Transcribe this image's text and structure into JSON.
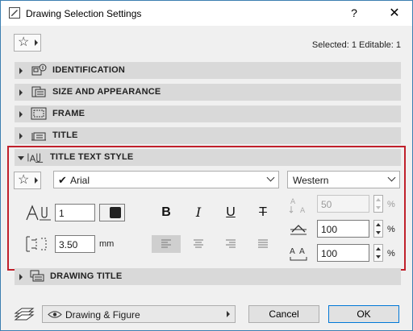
{
  "window": {
    "title": "Drawing Selection Settings",
    "help_label": "?",
    "close_label": "✕"
  },
  "toolbar": {
    "selection_info": "Selected: 1 Editable: 1"
  },
  "panels": [
    {
      "label": "IDENTIFICATION",
      "icon": "identification-icon",
      "expanded": false
    },
    {
      "label": "SIZE AND APPEARANCE",
      "icon": "size-appearance-icon",
      "expanded": false
    },
    {
      "label": "FRAME",
      "icon": "frame-icon",
      "expanded": false
    },
    {
      "label": "TITLE",
      "icon": "title-icon",
      "expanded": false
    },
    {
      "label": "TITLE TEXT STYLE",
      "icon": "title-text-style-icon",
      "expanded": true
    },
    {
      "label": "DRAWING TITLE",
      "icon": "drawing-title-icon",
      "expanded": false
    }
  ],
  "text_style": {
    "font": {
      "checked": true,
      "value": "Arial"
    },
    "script": "Western",
    "pen_number": "1",
    "text_height": "3.50",
    "text_height_unit": "mm",
    "char_spacing": {
      "value": "50",
      "unit": "%",
      "enabled": false
    },
    "line_spacing": {
      "value": "100",
      "unit": "%"
    },
    "char_width": {
      "value": "100",
      "unit": "%"
    },
    "format_buttons": {
      "bold": "B",
      "italic": "I",
      "underline": "U",
      "strikethrough": "T"
    },
    "alignment": {
      "active": "left",
      "options": [
        "left",
        "center",
        "right",
        "justify"
      ]
    }
  },
  "footer": {
    "layer": "Drawing & Figure",
    "cancel_label": "Cancel",
    "ok_label": "OK"
  },
  "colors": {
    "highlight_border": "#c0202b",
    "panel_header": "#d9d9d9",
    "dialog_bg": "#f0f0f0",
    "ok_border": "#0078d7"
  }
}
